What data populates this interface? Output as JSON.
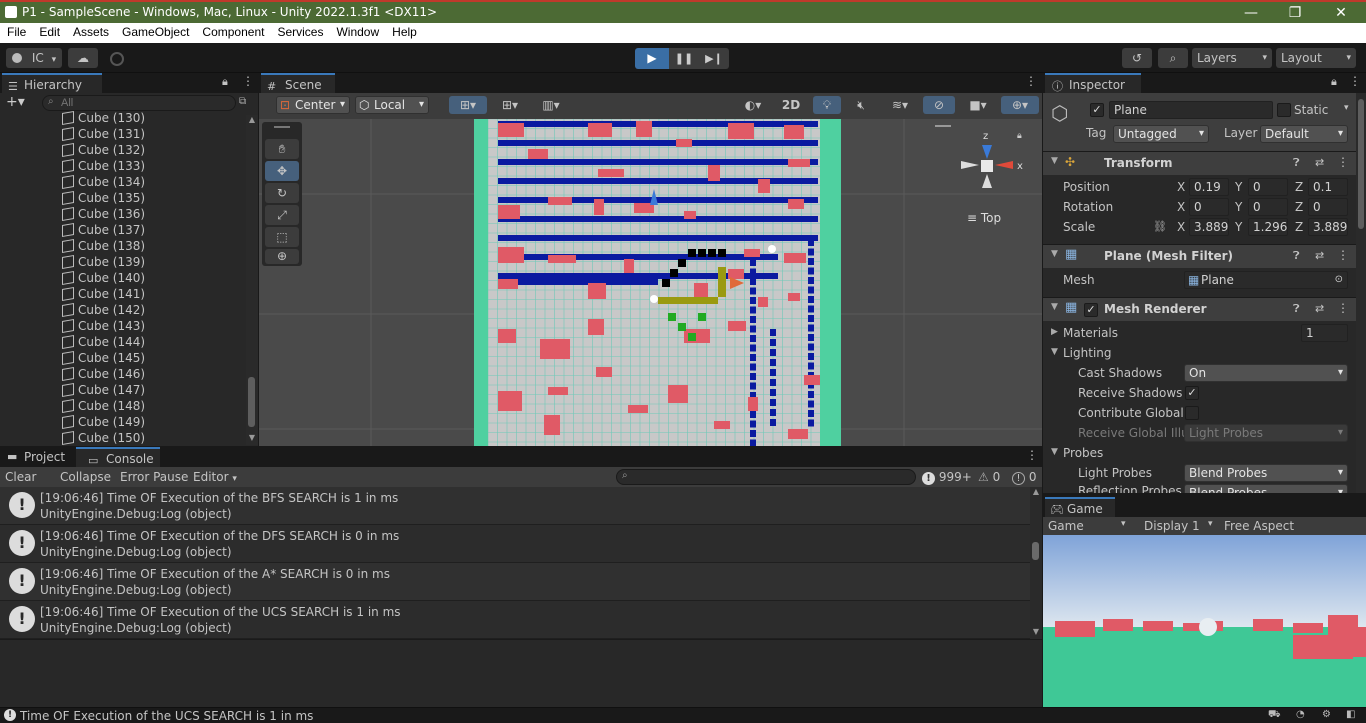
{
  "window": {
    "title": "P1 - SampleScene - Windows, Mac, Linux - Unity 2022.1.3f1 <DX11>",
    "minimize": "—",
    "maximize": "❐",
    "close": "✕"
  },
  "menu": [
    "File",
    "Edit",
    "Assets",
    "GameObject",
    "Component",
    "Services",
    "Window",
    "Help"
  ],
  "toolbar": {
    "account": "IC",
    "layers": "Layers",
    "layout": "Layout"
  },
  "hierarchy": {
    "tab": "Hierarchy",
    "search_placeholder": "All",
    "items": [
      "Cube (130)",
      "Cube (131)",
      "Cube (132)",
      "Cube (133)",
      "Cube (134)",
      "Cube (135)",
      "Cube (136)",
      "Cube (137)",
      "Cube (138)",
      "Cube (139)",
      "Cube (140)",
      "Cube (141)",
      "Cube (142)",
      "Cube (143)",
      "Cube (144)",
      "Cube (145)",
      "Cube (146)",
      "Cube (147)",
      "Cube (148)",
      "Cube (149)",
      "Cube (150)"
    ]
  },
  "scene": {
    "tab": "Scene",
    "pivot": "Center",
    "space": "Local",
    "mode2d": "2D",
    "gizmo_view": "Top",
    "gizmo_axes": {
      "z": "z",
      "x": "x"
    }
  },
  "inspector": {
    "tab": "Inspector",
    "object_name": "Plane",
    "static": "Static",
    "tag_label": "Tag",
    "tag": "Untagged",
    "layer_label": "Layer",
    "layer": "Default",
    "transform": {
      "title": "Transform",
      "position_label": "Position",
      "rotation_label": "Rotation",
      "scale_label": "Scale",
      "position": {
        "x": "0.19",
        "y": "0",
        "z": "0.1"
      },
      "rotation": {
        "x": "0",
        "y": "0",
        "z": "0"
      },
      "scale": {
        "x": "3.8896",
        "y": "1.2965",
        "z": "3.8896"
      }
    },
    "mesh_filter": {
      "title": "Plane (Mesh Filter)",
      "mesh_label": "Mesh",
      "mesh": "Plane"
    },
    "mesh_renderer": {
      "title": "Mesh Renderer",
      "materials_label": "Materials",
      "materials_count": "1",
      "lighting_label": "Lighting",
      "cast_shadows_label": "Cast Shadows",
      "cast_shadows": "On",
      "receive_shadows_label": "Receive Shadows",
      "contribute_gi_label": "Contribute Global I",
      "receive_gi_label": "Receive Global Illu",
      "receive_gi": "Light Probes",
      "probes_label": "Probes",
      "light_probes_label": "Light Probes",
      "light_probes": "Blend Probes",
      "reflection_probes_label": "Reflection Probes",
      "reflection_probes": "Blend Probes"
    }
  },
  "bottom": {
    "project_tab": "Project",
    "console_tab": "Console",
    "clear": "Clear",
    "collapse": "Collapse",
    "error_pause": "Error Pause",
    "editor": "Editor",
    "counts": {
      "info": "999+",
      "warn": "0",
      "error": "0"
    },
    "logs": [
      {
        "line1": "[19:06:46] Time OF Execution of the BFS SEARCH is 1 in ms",
        "line2": "UnityEngine.Debug:Log (object)"
      },
      {
        "line1": "[19:06:46] Time OF Execution of the DFS SEARCH is 0 in ms",
        "line2": "UnityEngine.Debug:Log (object)"
      },
      {
        "line1": "[19:06:46] Time OF Execution of the A* SEARCH is 0 in ms",
        "line2": "UnityEngine.Debug:Log (object)"
      },
      {
        "line1": "[19:06:46] Time OF Execution of the UCS SEARCH is 1 in ms",
        "line2": "UnityEngine.Debug:Log (object)"
      }
    ]
  },
  "game": {
    "tab": "Game",
    "mode": "Game",
    "display": "Display 1",
    "aspect": "Free Aspect"
  },
  "status": {
    "message": "Time OF Execution of the UCS SEARCH is 1 in ms"
  },
  "colors": {
    "accent": "#3a79bb",
    "title_bar": "#4c6a34",
    "grid_blue": "#0a1aa0",
    "obstacle_red": "#e05a66",
    "path_olive": "#9a9a10",
    "goal_green": "#22aa22",
    "ground_teal": "#3fc896"
  }
}
